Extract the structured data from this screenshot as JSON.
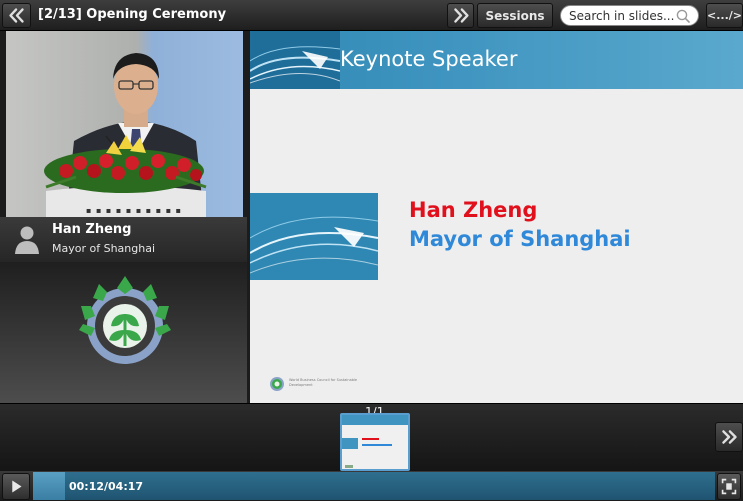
{
  "header": {
    "title": "[2/13] Opening Ceremony",
    "sessions_label": "Sessions",
    "search_placeholder": "Search in slides...",
    "embed_label": "<.../>"
  },
  "speaker": {
    "name": "Han Zheng",
    "role": "Mayor of Shanghai"
  },
  "slide": {
    "heading": "Keynote Speaker",
    "name": "Han Zheng",
    "role": "Mayor of Shanghai",
    "footer_text": "World Business Council for Sustainable Development"
  },
  "filmstrip": {
    "counter": "1/1"
  },
  "player": {
    "time": "00:12/04:17",
    "progress_fraction": 0.047
  },
  "icons": {
    "prev": "double-chevron-left-icon",
    "next": "double-chevron-right-icon",
    "search": "magnifier-icon",
    "avatar": "person-silhouette-icon",
    "play": "play-icon",
    "fullscreen": "fullscreen-icon"
  },
  "colors": {
    "accent_blue": "#3f95c0",
    "slide_name_red": "#e0111d",
    "slide_role_blue": "#2f88d8",
    "logo_green": "#3aa84a",
    "logo_gear": "#8aa2c8"
  }
}
